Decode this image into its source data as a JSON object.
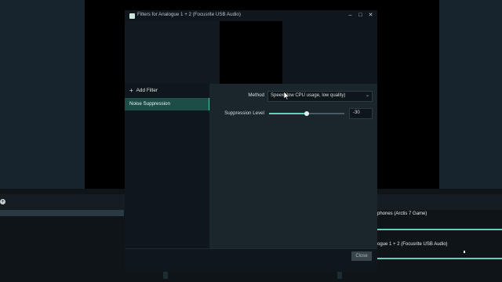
{
  "dialog": {
    "title": "Filters for Analogue 1 + 2 (Focusrite USB Audio)",
    "window_controls": {
      "minimize": "–",
      "maximize": "□",
      "close": "✕"
    },
    "add_filter_label": "Add Filter",
    "add_filter_icon": "+",
    "filters": [
      {
        "label": "Noise Suppression",
        "selected": true
      }
    ],
    "properties": {
      "method_label": "Method",
      "method_value": "Speex (low CPU usage, low quality)",
      "chevron": "⌄",
      "suppression_label": "Suppression Level",
      "suppression_value": "-30",
      "suppression_fraction": 0.5
    },
    "close_label": "Close"
  },
  "mixer": {
    "add_icon": "+",
    "channels": [
      {
        "name": "phones (Arctis 7 Game)"
      },
      {
        "name": "ogue 1 + 2 (Focusrite USB Audio)"
      }
    ]
  },
  "colors": {
    "accent": "#5fd1b8",
    "selected_bg": "#1d4d47",
    "panel_bg": "#1a252c"
  }
}
